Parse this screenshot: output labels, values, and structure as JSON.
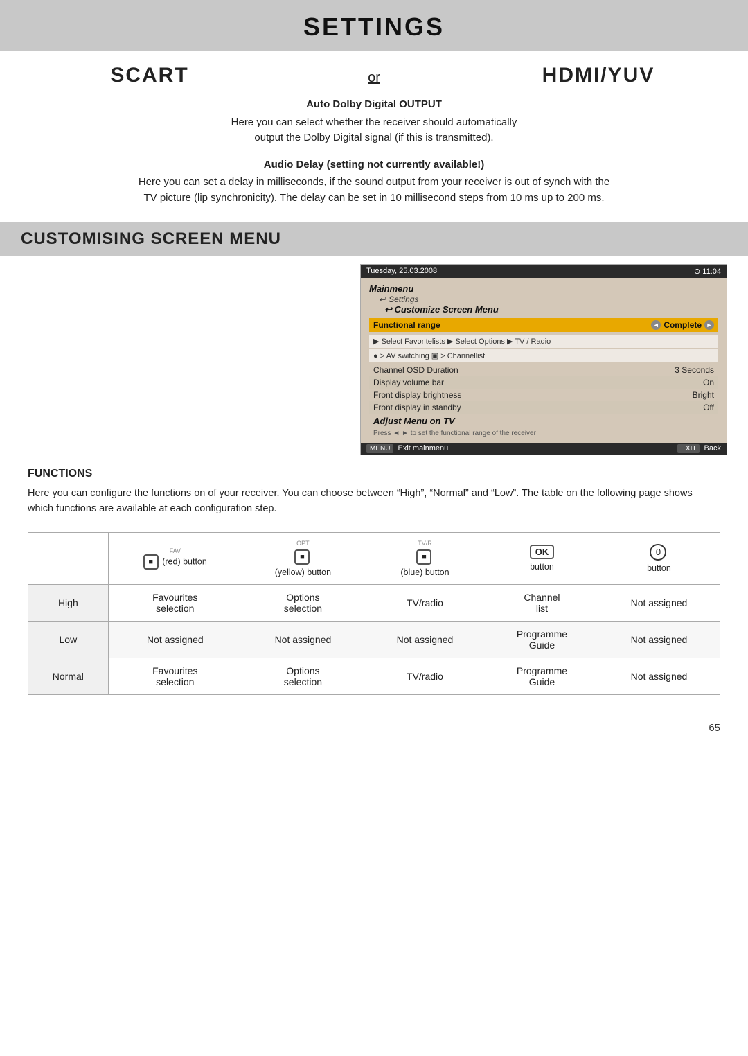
{
  "header": {
    "title": "SETTINGS"
  },
  "scart_row": {
    "scart": "SCART",
    "or": "or",
    "hdmi": "HDMI/YUV"
  },
  "auto_dolby": {
    "title": "Auto Dolby Digital OUTPUT",
    "body": "Here you can select whether the receiver should automatically\noutput the Dolby Digital signal (if this is transmitted)."
  },
  "audio_delay": {
    "title": "Audio Delay (setting not currently available!)",
    "body": "Here you can set a delay in milliseconds, if the sound output from your receiver is out of synch with the\nTV picture (lip synchronicity). The delay can be set in 10 millisecond steps from 10 ms up to 200 ms."
  },
  "customising": {
    "title": "CUSTOMISING SCREEN MENU"
  },
  "screen_menu": {
    "top_bar_left": "Tuesday, 25.03.2008",
    "top_bar_right": "⊙ 11:04",
    "mainmenu": "Mainmenu",
    "settings": "Settings",
    "customize": "Customize Screen Menu",
    "functional_range": "Functional range",
    "complete": "Complete",
    "icon_row1": "▶ Select Favoritelists  ▶ Select Options  ▶ TV / Radio",
    "icon_row2": "● > AV switching  ▣ > Channellist",
    "rows": [
      {
        "label": "Channel OSD Duration",
        "value": "3 Seconds"
      },
      {
        "label": "Display volume bar",
        "value": "On"
      },
      {
        "label": "Front display brightness",
        "value": "Bright"
      },
      {
        "label": "Front display in standby",
        "value": "Off"
      }
    ],
    "adjust": "Adjust Menu on TV",
    "hint": "Press ◄ ► to set the functional range of the receiver",
    "bottom_left": "MENU  Exit mainmenu",
    "bottom_right": "EXIT  Back"
  },
  "functions": {
    "title": "FUNCTIONS",
    "description": "Here you can configure the functions on of your receiver. You can choose between \"High\", \"Normal\" and \"Low\". The table on the following page shows which functions are available at each configuration step.",
    "table": {
      "headers": [
        {
          "id": "label",
          "content": ""
        },
        {
          "id": "red",
          "icon": "red-button-icon",
          "label_small": "FAV",
          "text": "(red) button"
        },
        {
          "id": "yellow",
          "icon": "yellow-button-icon",
          "label_small": "OPT",
          "text": "(yellow) button"
        },
        {
          "id": "blue",
          "icon": "blue-button-icon",
          "label_small": "TV/R",
          "text": "(blue) button"
        },
        {
          "id": "ok",
          "icon": "ok-button-icon",
          "text": "button",
          "symbol": "OK"
        },
        {
          "id": "zero",
          "icon": "zero-button-icon",
          "text": "button",
          "symbol": "0"
        }
      ],
      "rows": [
        {
          "row_label": "High",
          "cells": [
            "Favourites\nselection",
            "Options\nselection",
            "TV/radio",
            "Channel\nlist",
            "Not assigned"
          ]
        },
        {
          "row_label": "Low",
          "cells": [
            "Not assigned",
            "Not assigned",
            "Not assigned",
            "Programme\nGuide",
            "Not assigned"
          ]
        },
        {
          "row_label": "Normal",
          "cells": [
            "Favourites\nselection",
            "Options\nselection",
            "TV/radio",
            "Programme\nGuide",
            "Not assigned"
          ]
        }
      ]
    }
  },
  "footer": {
    "page_number": "65"
  }
}
